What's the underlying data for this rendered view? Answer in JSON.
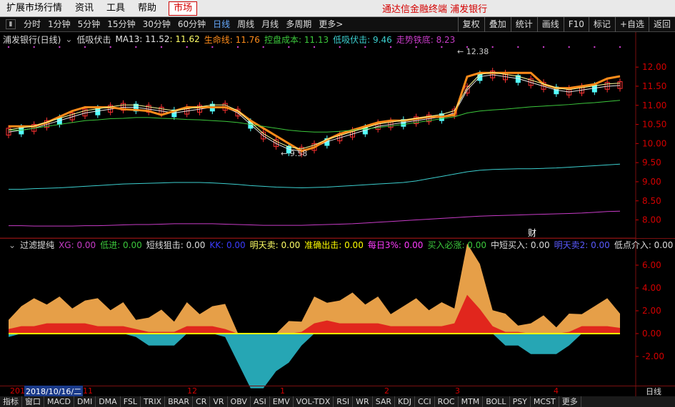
{
  "menu": {
    "items": [
      "扩展市场行情",
      "资讯",
      "工具",
      "帮助"
    ],
    "market": "市场",
    "title": "通达信金融终端  浦发银行"
  },
  "periods": {
    "items": [
      "分时",
      "1分钟",
      "5分钟",
      "15分钟",
      "30分钟",
      "60分钟",
      "日线",
      "周线",
      "月线",
      "多周期",
      "更多>"
    ],
    "active": "日线",
    "right": [
      "复权",
      "叠加",
      "统计",
      "画线",
      "F10",
      "标记",
      "+自选",
      "返回"
    ]
  },
  "main_legend": {
    "stock": "浦发银行(日线)",
    "indicator": "低吸伏击",
    "ma13": "MA13: 11.52",
    "val2": ": 11.62",
    "life": "生命线: 11.76",
    "cost": "控盘成本: 11.13",
    "ambush": "低吸伏击: 9.46",
    "trend": "走势铁底: 8.23"
  },
  "sub_legend": {
    "name": "过滤提纯",
    "xg": "XG: 0.00",
    "dijin": "低进: 0.00",
    "short": "短线狙击: 0.00",
    "kk": "KK: 0.00",
    "sell": "明天卖: 0.00",
    "out": "准确出击: 0.00",
    "daily": "每日3%: 0.00",
    "buy": "买入必涨: 0.00",
    "mid": "中短买入: 0.00",
    "sell2": "明天卖2: 0.00",
    "low": "低点介入: 0.00"
  },
  "colors": {
    "up": "#ff3232",
    "down": "#54ffff",
    "orange": "#ff8c1a",
    "green": "#3cc83c",
    "cyan": "#3ccfcf",
    "magenta": "#c83cc8",
    "white": "#e6e6e6",
    "yellow": "#ffff00"
  },
  "chart_data": {
    "type": "line",
    "title": "浦发银行(日线)",
    "y_ticks": [
      "12.00",
      "11.50",
      "11.00",
      "10.50",
      "10.00",
      "9.50",
      "9.00",
      "8.50",
      "8.00"
    ],
    "annotations": [
      "12.38",
      "9.58",
      "财"
    ],
    "sub_y_ticks": [
      "6.00",
      "4.00",
      "2.00",
      "0.00",
      "-2.00"
    ],
    "x_labels": [
      "201",
      "2018/10/16/二",
      "11",
      "12",
      "1",
      "2",
      "3",
      "4"
    ],
    "ylim": [
      7.6,
      12.6
    ],
    "series": [
      {
        "name": "MA13",
        "values": [
          10.3,
          10.35,
          10.4,
          10.5,
          10.6,
          10.7,
          10.8,
          10.85,
          10.9,
          10.95,
          10.95,
          10.9,
          10.85,
          10.8,
          10.85,
          10.9,
          10.95,
          10.95,
          10.8,
          10.5,
          10.2,
          10.0,
          9.85,
          9.8,
          9.9,
          10.05,
          10.15,
          10.25,
          10.35,
          10.45,
          10.5,
          10.55,
          10.6,
          10.65,
          10.7,
          10.8,
          11.4,
          11.75,
          11.8,
          11.75,
          11.7,
          11.6,
          11.5,
          11.4,
          11.35,
          11.4,
          11.45,
          11.5,
          11.52
        ]
      },
      {
        "name": "生命线",
        "values": [
          10.45,
          10.45,
          10.45,
          10.55,
          10.7,
          10.85,
          10.95,
          10.95,
          10.95,
          10.9,
          10.88,
          10.85,
          10.75,
          10.85,
          10.95,
          10.95,
          10.95,
          10.95,
          10.85,
          10.6,
          10.4,
          10.2,
          10.0,
          9.8,
          9.9,
          10.1,
          10.25,
          10.35,
          10.45,
          10.55,
          10.6,
          10.6,
          10.65,
          10.7,
          10.7,
          10.75,
          11.75,
          11.85,
          11.85,
          11.85,
          11.85,
          11.85,
          11.55,
          11.45,
          11.45,
          11.5,
          11.55,
          11.7,
          11.76
        ]
      },
      {
        "name": "控盘成本",
        "values": [
          10.35,
          10.35,
          10.4,
          10.45,
          10.5,
          10.55,
          10.6,
          10.62,
          10.65,
          10.66,
          10.68,
          10.68,
          10.66,
          10.65,
          10.63,
          10.62,
          10.6,
          10.58,
          10.55,
          10.5,
          10.45,
          10.4,
          10.35,
          10.32,
          10.3,
          10.3,
          10.32,
          10.35,
          10.38,
          10.42,
          10.46,
          10.5,
          10.55,
          10.6,
          10.65,
          10.7,
          10.8,
          10.85,
          10.88,
          10.9,
          10.93,
          10.96,
          10.98,
          11.0,
          11.02,
          11.05,
          11.07,
          11.1,
          11.13
        ]
      },
      {
        "name": "低吸伏击",
        "values": [
          8.8,
          8.8,
          8.82,
          8.83,
          8.84,
          8.86,
          8.88,
          8.9,
          8.92,
          8.94,
          8.95,
          8.96,
          8.97,
          8.98,
          8.98,
          8.98,
          8.97,
          8.95,
          8.93,
          8.9,
          8.88,
          8.86,
          8.85,
          8.84,
          8.85,
          8.86,
          8.88,
          8.9,
          8.92,
          8.94,
          8.96,
          8.98,
          9.02,
          9.08,
          9.14,
          9.2,
          9.26,
          9.3,
          9.32,
          9.33,
          9.34,
          9.34,
          9.35,
          9.36,
          9.38,
          9.4,
          9.42,
          9.44,
          9.46
        ]
      },
      {
        "name": "走势铁底",
        "values": [
          7.85,
          7.85,
          7.84,
          7.84,
          7.84,
          7.84,
          7.85,
          7.85,
          7.86,
          7.87,
          7.88,
          7.88,
          7.89,
          7.9,
          7.9,
          7.9,
          7.9,
          7.89,
          7.88,
          7.87,
          7.86,
          7.86,
          7.86,
          7.86,
          7.87,
          7.88,
          7.89,
          7.9,
          7.92,
          7.94,
          7.96,
          7.98,
          8.0,
          8.02,
          8.04,
          8.06,
          8.08,
          8.1,
          8.11,
          8.12,
          8.13,
          8.14,
          8.15,
          8.16,
          8.17,
          8.18,
          8.2,
          8.22,
          8.23
        ]
      }
    ]
  },
  "tabs": [
    "指标",
    "窗口",
    "MACD",
    "DMI",
    "DMA",
    "FSL",
    "TRIX",
    "BRAR",
    "CR",
    "VR",
    "OBV",
    "ASI",
    "EMV",
    "VOL-TDX",
    "RSI",
    "WR",
    "SAR",
    "KDJ",
    "CCI",
    "ROC",
    "MTM",
    "BOLL",
    "PSY",
    "MCST",
    "更多"
  ],
  "bottom_right": "日线"
}
